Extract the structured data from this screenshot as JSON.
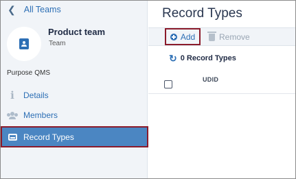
{
  "sidebar": {
    "back_label": "All Teams",
    "team": {
      "name": "Product team",
      "type": "Team"
    },
    "purpose_label": "Purpose",
    "purpose_value": "QMS",
    "items": [
      {
        "label": "Details",
        "icon": "info-icon"
      },
      {
        "label": "Members",
        "icon": "members-icon"
      },
      {
        "label": "Record Types",
        "icon": "record-types-icon",
        "active": true
      }
    ]
  },
  "main": {
    "title": "Record Types",
    "toolbar": {
      "add_label": "Add",
      "remove_label": "Remove"
    },
    "count_label": "0 Record Types",
    "table": {
      "columns": [
        "UDID"
      ]
    }
  },
  "colors": {
    "accent": "#2d6fb5",
    "active_bg": "#4b86c2",
    "highlight_border": "#8b1a2a",
    "sidebar_bg": "#f1f4f8"
  }
}
